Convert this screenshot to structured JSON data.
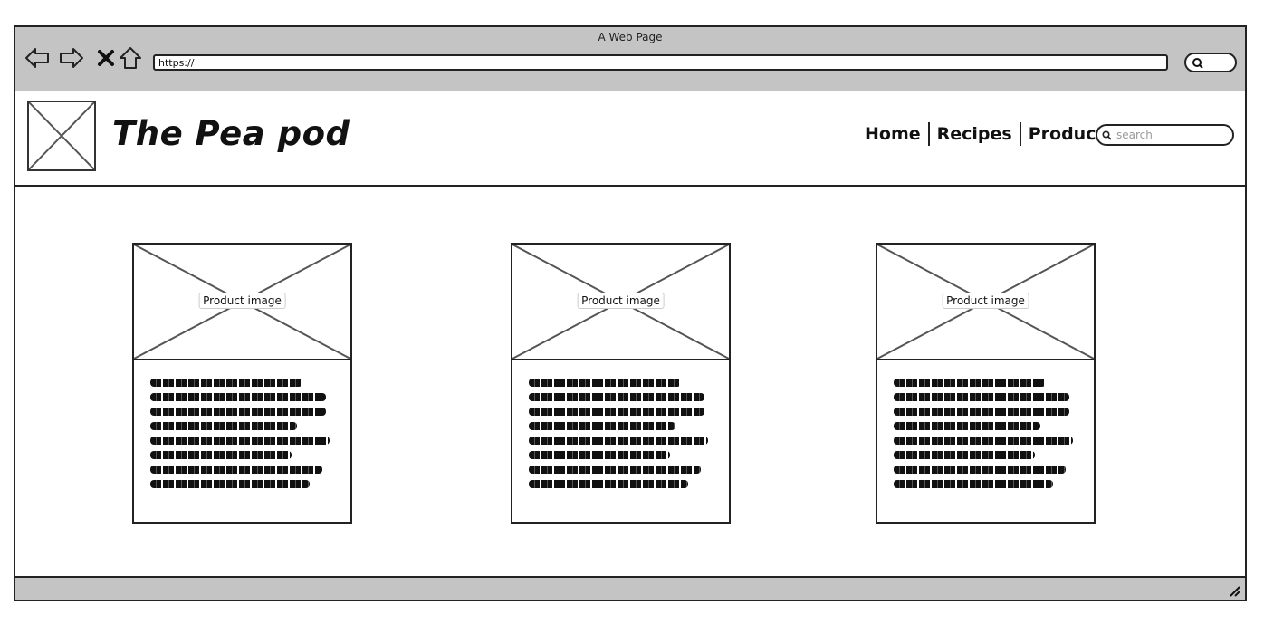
{
  "browser": {
    "window_title": "A Web Page",
    "url": "https://"
  },
  "site": {
    "title": "The Pea pod",
    "nav": [
      "Home",
      "Recipes",
      "Products"
    ],
    "search_placeholder": "search"
  },
  "products": [
    {
      "image_label": "Product image"
    },
    {
      "image_label": "Product image"
    },
    {
      "image_label": "Product image"
    }
  ]
}
